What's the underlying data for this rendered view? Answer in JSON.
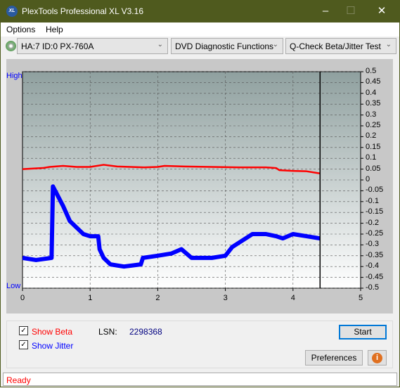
{
  "window": {
    "title": "PlexTools Professional XL V3.16",
    "logo_text": "XL"
  },
  "menu": {
    "items": [
      {
        "label": "Options",
        "accel": "O"
      },
      {
        "label": "Help",
        "accel": "H"
      }
    ]
  },
  "toolbar": {
    "drive": "HA:7 ID:0  PX-760A",
    "function": "DVD Diagnostic Functions",
    "test": "Q-Check Beta/Jitter Test"
  },
  "chart_data": {
    "type": "line",
    "xlim": [
      0,
      5
    ],
    "ylim": [
      -0.5,
      0.5
    ],
    "x_ticks": [
      "0",
      "1",
      "2",
      "3",
      "4",
      "5"
    ],
    "y_ticks": [
      "0.5",
      "0.45",
      "0.4",
      "0.35",
      "0.3",
      "0.25",
      "0.2",
      "0.15",
      "0.1",
      "0.05",
      "0",
      "-0.05",
      "-0.1",
      "-0.15",
      "-0.2",
      "-0.25",
      "-0.3",
      "-0.35",
      "-0.4",
      "-0.45",
      "-0.5"
    ],
    "left_labels": {
      "high": "High",
      "low": "Low"
    },
    "grid": true,
    "cursor_x": 4.4,
    "series": [
      {
        "key": "beta",
        "color": "#ff0000",
        "points": [
          [
            0,
            0.05
          ],
          [
            0.3,
            0.055
          ],
          [
            0.4,
            0.06
          ],
          [
            0.6,
            0.065
          ],
          [
            0.8,
            0.06
          ],
          [
            1.0,
            0.06
          ],
          [
            1.2,
            0.07
          ],
          [
            1.4,
            0.062
          ],
          [
            1.6,
            0.06
          ],
          [
            1.8,
            0.058
          ],
          [
            2.0,
            0.06
          ],
          [
            2.1,
            0.065
          ],
          [
            2.4,
            0.062
          ],
          [
            2.8,
            0.06
          ],
          [
            3.2,
            0.058
          ],
          [
            3.6,
            0.058
          ],
          [
            3.75,
            0.055
          ],
          [
            3.8,
            0.045
          ],
          [
            4.0,
            0.042
          ],
          [
            4.2,
            0.04
          ],
          [
            4.4,
            0.03
          ]
        ]
      },
      {
        "key": "jitter",
        "color": "#0000ff",
        "points": [
          [
            0,
            -0.36
          ],
          [
            0.2,
            -0.37
          ],
          [
            0.43,
            -0.36
          ],
          [
            0.45,
            -0.03
          ],
          [
            0.5,
            -0.06
          ],
          [
            0.6,
            -0.12
          ],
          [
            0.7,
            -0.19
          ],
          [
            0.8,
            -0.22
          ],
          [
            0.9,
            -0.25
          ],
          [
            1.0,
            -0.26
          ],
          [
            1.12,
            -0.26
          ],
          [
            1.14,
            -0.32
          ],
          [
            1.2,
            -0.36
          ],
          [
            1.3,
            -0.39
          ],
          [
            1.5,
            -0.4
          ],
          [
            1.75,
            -0.39
          ],
          [
            1.78,
            -0.36
          ],
          [
            2.0,
            -0.35
          ],
          [
            2.2,
            -0.34
          ],
          [
            2.35,
            -0.32
          ],
          [
            2.5,
            -0.36
          ],
          [
            2.8,
            -0.36
          ],
          [
            3.0,
            -0.35
          ],
          [
            3.1,
            -0.31
          ],
          [
            3.25,
            -0.28
          ],
          [
            3.4,
            -0.25
          ],
          [
            3.6,
            -0.25
          ],
          [
            3.75,
            -0.26
          ],
          [
            3.85,
            -0.27
          ],
          [
            4.0,
            -0.25
          ],
          [
            4.2,
            -0.26
          ],
          [
            4.4,
            -0.27
          ]
        ]
      }
    ]
  },
  "options": {
    "show_beta": {
      "label": "Show Beta",
      "checked": true,
      "color": "#ff0000"
    },
    "show_jitter": {
      "label": "Show Jitter",
      "checked": true,
      "color": "#0000ff"
    }
  },
  "lsn": {
    "label": "LSN:",
    "value": "2298368"
  },
  "buttons": {
    "start": "Start",
    "preferences": "Preferences",
    "info": "i"
  },
  "status": "Ready"
}
